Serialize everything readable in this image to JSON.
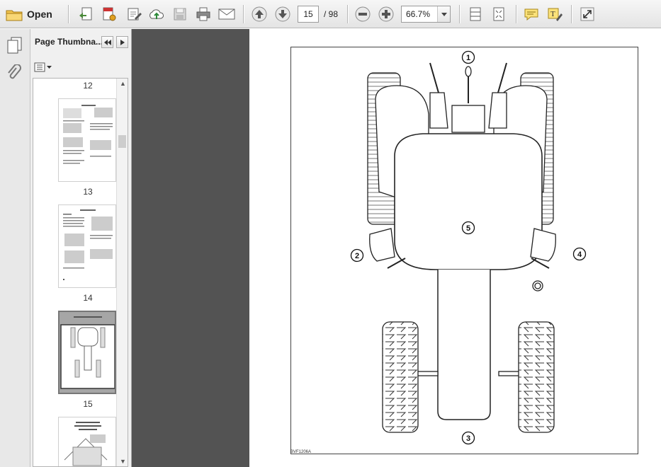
{
  "toolbar": {
    "open_label": "Open",
    "page_current": "15",
    "page_total": "/ 98",
    "zoom": "66.7%"
  },
  "thumbnails_panel": {
    "title": "Page Thumbna...",
    "pages": [
      {
        "label": "12"
      },
      {
        "label": "13"
      },
      {
        "label": "14"
      },
      {
        "label": "15"
      }
    ]
  },
  "document": {
    "figure_code": "BVF1206A",
    "callouts": [
      "1",
      "2",
      "3",
      "4",
      "5"
    ]
  }
}
